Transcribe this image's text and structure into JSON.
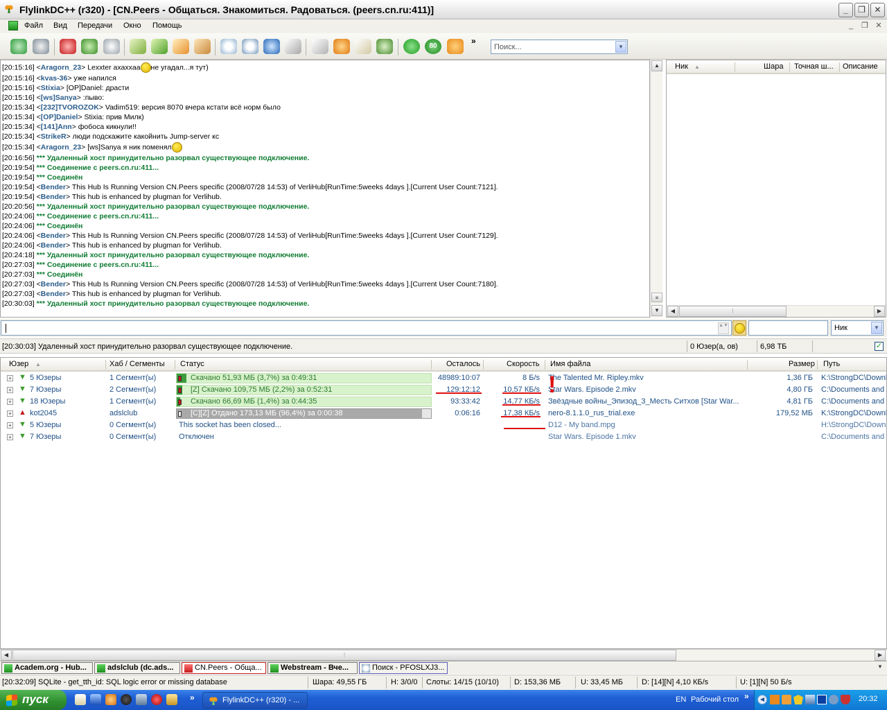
{
  "window": {
    "title": "FlylinkDC++ (r320) - [CN.Peers -  Общаться. Знакомиться. Радоваться. (peers.cn.ru:411)]"
  },
  "menu": [
    "Файл",
    "Вид",
    "Передачи",
    "Окно",
    "Помощь"
  ],
  "toolbar": {
    "search_placeholder": "Поиск...",
    "icons": [
      "reconnect-icon",
      "follow-redirect-icon",
      "favorite-hubs-icon",
      "favorite-users-icon",
      "recent-hubs-icon",
      "download-queue-icon",
      "finished-downloads-icon",
      "upload-queue-icon",
      "finished-uploads-icon",
      "search-icon",
      "adl-search-icon",
      "search-spy-icon",
      "notepad-icon",
      "open-filelist-icon",
      "public-hubs-icon",
      "settings-icon",
      "network-stats-icon",
      "away-icon",
      "limiter-icon",
      "plugin-icon",
      "more-icon"
    ],
    "limiter_label": "80",
    "more_label": "»"
  },
  "chat": {
    "lines": [
      {
        "time": "[20:15:16]",
        "nick": "Aragorn_23",
        "text": "Lexxter ахахxаа",
        "smiley": true,
        "text2": "не угадал...я тут)"
      },
      {
        "time": "[20:15:16]",
        "nick": "kvas-36",
        "text": "уже напился"
      },
      {
        "time": "[20:15:16]",
        "nick": "Stixia",
        "text": "[OP]Daniel: драсти"
      },
      {
        "time": "[20:15:16]",
        "nick": "[ws]Sanya",
        "text": ":пыво:"
      },
      {
        "time": "[20:15:34]",
        "nick": "[232]TVOROZOK",
        "text": "Vadim519: версия 8070 вчера кстати всё норм было"
      },
      {
        "time": "[20:15:34]",
        "nick": "[OP]Daniel",
        "text": "Stixia: прив Милк)"
      },
      {
        "time": "[20:15:34]",
        "nick": "[141]Ann",
        "text": "фобоса кикнули!!"
      },
      {
        "time": "[20:15:34]",
        "nick": "StrikeR",
        "text": "люди подскажите какойнить Jump-server кс"
      },
      {
        "time": "[20:15:34]",
        "nick": "Aragorn_23",
        "text": "[ws]Sanya я ник поменял",
        "smiley": true,
        "text2": ""
      },
      {
        "time": "[20:16:56]",
        "sys": "*** Удаленный хост принудительно разорвал существующее подключение."
      },
      {
        "time": "[20:19:54]",
        "sys": "*** Соединение с peers.cn.ru:411..."
      },
      {
        "time": "[20:19:54]",
        "sys": "*** Соединён"
      },
      {
        "time": "[20:19:54]",
        "nick": "Bender",
        "text": "This Hub Is Running Version CN.Peers specific (2008/07/28 14:53) of VerliHub[RunTime:5weeks 4days ].[Current User Count:7121]."
      },
      {
        "time": "[20:19:54]",
        "nick": "Bender",
        "text": "This hub is enhanced by plugman for Verlihub."
      },
      {
        "time": "[20:20:56]",
        "sys": "*** Удаленный хост принудительно разорвал существующее подключение."
      },
      {
        "time": "[20:24:06]",
        "sys": "*** Соединение с peers.cn.ru:411..."
      },
      {
        "time": "[20:24:06]",
        "sys": "*** Соединён"
      },
      {
        "time": "[20:24:06]",
        "nick": "Bender",
        "text": "This Hub Is Running Version CN.Peers specific (2008/07/28 14:53) of VerliHub[RunTime:5weeks 4days ].[Current User Count:7129]."
      },
      {
        "time": "[20:24:06]",
        "nick": "Bender",
        "text": "This hub is enhanced by plugman for Verlihub."
      },
      {
        "time": "[20:24:18]",
        "sys": "*** Удаленный хост принудительно разорвал существующее подключение."
      },
      {
        "time": "[20:27:03]",
        "sys": "*** Соединение с peers.cn.ru:411..."
      },
      {
        "time": "[20:27:03]",
        "sys": "*** Соединён"
      },
      {
        "time": "[20:27:03]",
        "nick": "Bender",
        "text": "This Hub Is Running Version CN.Peers specific (2008/07/28 14:53) of VerliHub[RunTime:5weeks 4days ].[Current User Count:7180]."
      },
      {
        "time": "[20:27:03]",
        "nick": "Bender",
        "text": "This hub is enhanced by plugman for Verlihub."
      },
      {
        "time": "[20:30:03]",
        "sys": "*** Удаленный хост принудительно разорвал существующее подключение."
      }
    ]
  },
  "userlist": {
    "columns": [
      "Ник",
      "Шара",
      "Точная ш...",
      "Описание"
    ]
  },
  "input": {
    "nick_select": "Ник"
  },
  "hub_status": {
    "message": "[20:30:03] Удаленный хост принудительно разорвал существующее подключение.",
    "users": "0 Юзер(а, ов)",
    "share": "6,98 ТБ"
  },
  "transfers": {
    "columns": [
      "Юзер",
      "Хаб / Сегменты",
      "Статус",
      "Осталось",
      "Скорость",
      "Имя файла",
      "Размер",
      "Путь"
    ],
    "rows": [
      {
        "user": "5 Юзеры",
        "hub": "1 Сегмент(ы)",
        "status": "Скачано 51,93 МБ (3,7%) за 0:49:31",
        "progress": 0.037,
        "left": "48989:10:07",
        "speed": "8 Б/s",
        "file": "The Talented Mr. Ripley.mkv",
        "size": "1,36 ГБ",
        "path": "K:\\StrongDC\\Downl",
        "type": "download"
      },
      {
        "user": "7 Юзеры",
        "hub": "2 Сегмент(ы)",
        "status": "[Z] Скачано 109,75 МБ (2,2%) за 0:52:31",
        "progress": 0.022,
        "left": "129:12:12",
        "speed": "10,57 КБ/s",
        "file": "Star Wars. Episode 2.mkv",
        "size": "4,80 ГБ",
        "path": "C:\\Documents and S",
        "type": "download"
      },
      {
        "user": "18 Юзеры",
        "hub": "1 Сегмент(ы)",
        "status": "Скачано 66,69 МБ (1,4%) за 0:44:35",
        "progress": 0.014,
        "left": "93:33:42",
        "speed": "14,77 КБ/s",
        "file": "Звёздные войны_Эпизод_3_Месть Ситхов [Star War...",
        "size": "4,81 ГБ",
        "path": "C:\\Documents and S",
        "type": "download"
      },
      {
        "user": "kot2045",
        "hub": "adslclub",
        "status": "[C][Z] Отдано 173,13 МБ (96,4%) за 0:00:38",
        "progress": 0.964,
        "left": "0:06:16",
        "speed": "17,38 КБ/s",
        "file": "nero-8.1.1.0_rus_trial.exe",
        "size": "179,52 МБ",
        "path": "K:\\StrongDC\\Downl",
        "type": "upload"
      },
      {
        "user": "5 Юзеры",
        "hub": "0 Сегмент(ы)",
        "status": "This socket has been closed...",
        "left": "",
        "speed": "",
        "file": "D12 - My band.mpg",
        "size": "",
        "path": "H:\\StrongDC\\Downl",
        "type": "idle"
      },
      {
        "user": "7 Юзеры",
        "hub": "0 Сегмент(ы)",
        "status": "Отключен",
        "left": "",
        "speed": "",
        "file": "Star Wars. Episode 1.mkv",
        "size": "",
        "path": "C:\\Documents and S",
        "type": "idle"
      }
    ],
    "annotation_mark": "!"
  },
  "tabs": [
    "Academ.org - Hub...",
    "adslclub (dc.ads...",
    "CN.Peers - Обща...",
    "Webstream - Вче...",
    "Поиск - PFOSLXJ3..."
  ],
  "statusbar": {
    "msg": "[20:32:09] SQLite - get_tth_id: SQL logic error or missing database",
    "share": "Шара: 49,55 ГБ",
    "hubs": "H: 3/0/0",
    "slots": "Слоты: 14/15 (10/10)",
    "down": "D: 153,36 МБ",
    "up": "U: 33,45 МБ",
    "dspeed": "D: [14][N] 4,10 КБ/s",
    "uspeed": "U: [1][N] 50 Б/s"
  },
  "taskbar": {
    "start": "пуск",
    "task": "FlylinkDC++ (r320) - ...",
    "lang": "EN",
    "desktop": "Рабочий стол",
    "clock": "20:32",
    "more": "»"
  }
}
